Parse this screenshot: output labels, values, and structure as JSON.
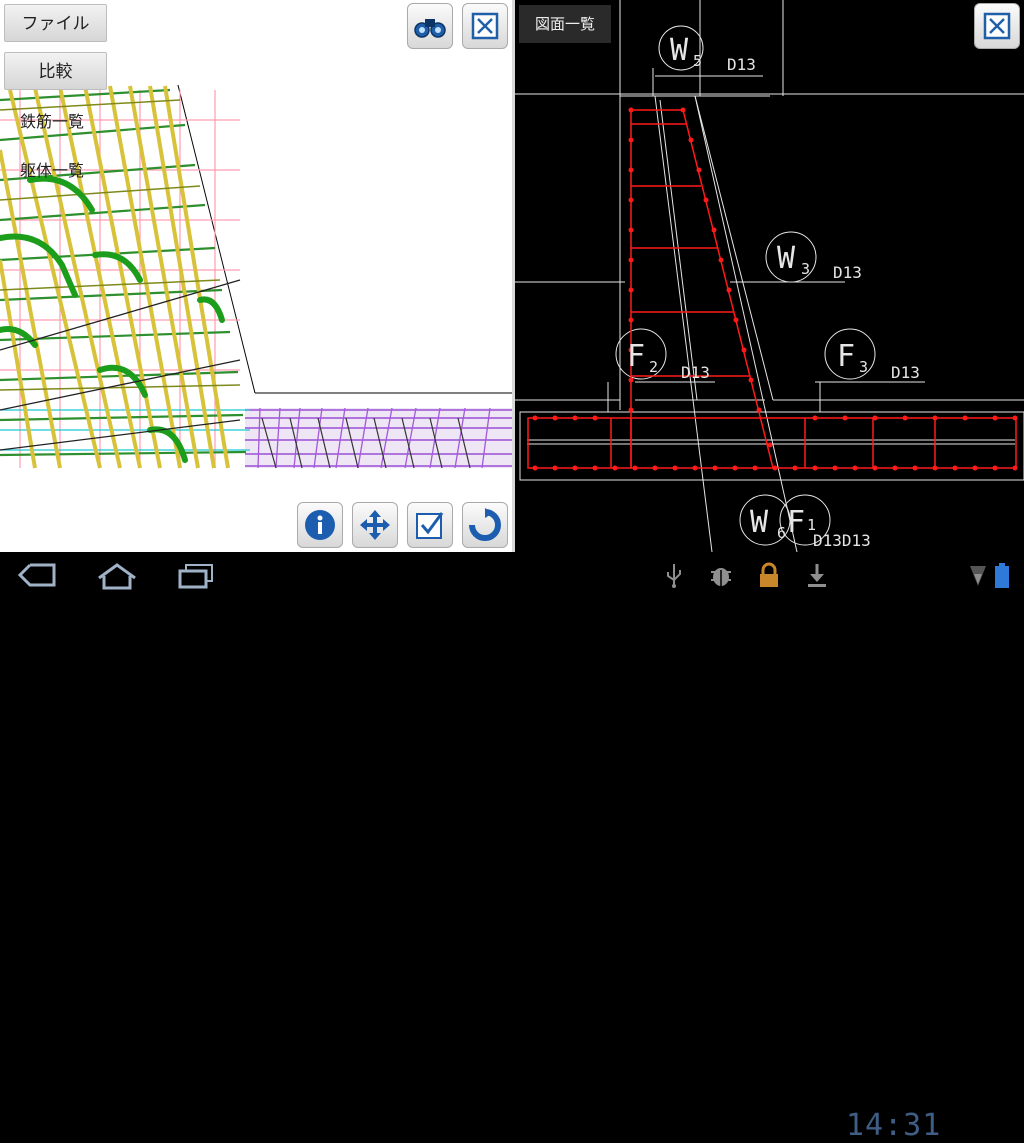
{
  "left_panel": {
    "menu": {
      "file_label": "ファイル",
      "compare_label": "比較",
      "rebar_list_label": "鉄筋一覧",
      "body_list_label": "躯体一覧"
    }
  },
  "right_panel": {
    "drawing_list_label": "図面一覧",
    "labels": {
      "w5_mark": "W",
      "w5_sub": "5",
      "w5_bar": "D13",
      "w3_mark": "W",
      "w3_sub": "3",
      "w3_bar": "D13",
      "f2_mark": "F",
      "f2_sub": "2",
      "f2_bar": "D13",
      "f3_mark": "F",
      "f3_sub": "3",
      "f3_bar": "D13",
      "w6_mark": "W",
      "w6_sub": "6",
      "f1_mark": "F",
      "f1_sub": "1",
      "bottom_bars": "D13D13"
    }
  },
  "status_bar": {
    "time": "14:31"
  },
  "icons": {
    "binoculars": "binoculars-icon",
    "close": "close-icon",
    "info": "info-icon",
    "move": "move-icon",
    "check": "check-icon",
    "rotate": "rotate-icon",
    "back": "back-icon",
    "home": "home-icon",
    "recent": "recent-apps-icon",
    "usb": "usb-icon",
    "debug": "debug-icon",
    "lock": "lock-icon",
    "download": "download-icon",
    "signal": "signal-icon",
    "battery": "battery-icon"
  },
  "colors": {
    "rebar_red": "#ff1a1a",
    "cad_line": "#e6e6e6",
    "clock_blue": "#3f5e86"
  }
}
